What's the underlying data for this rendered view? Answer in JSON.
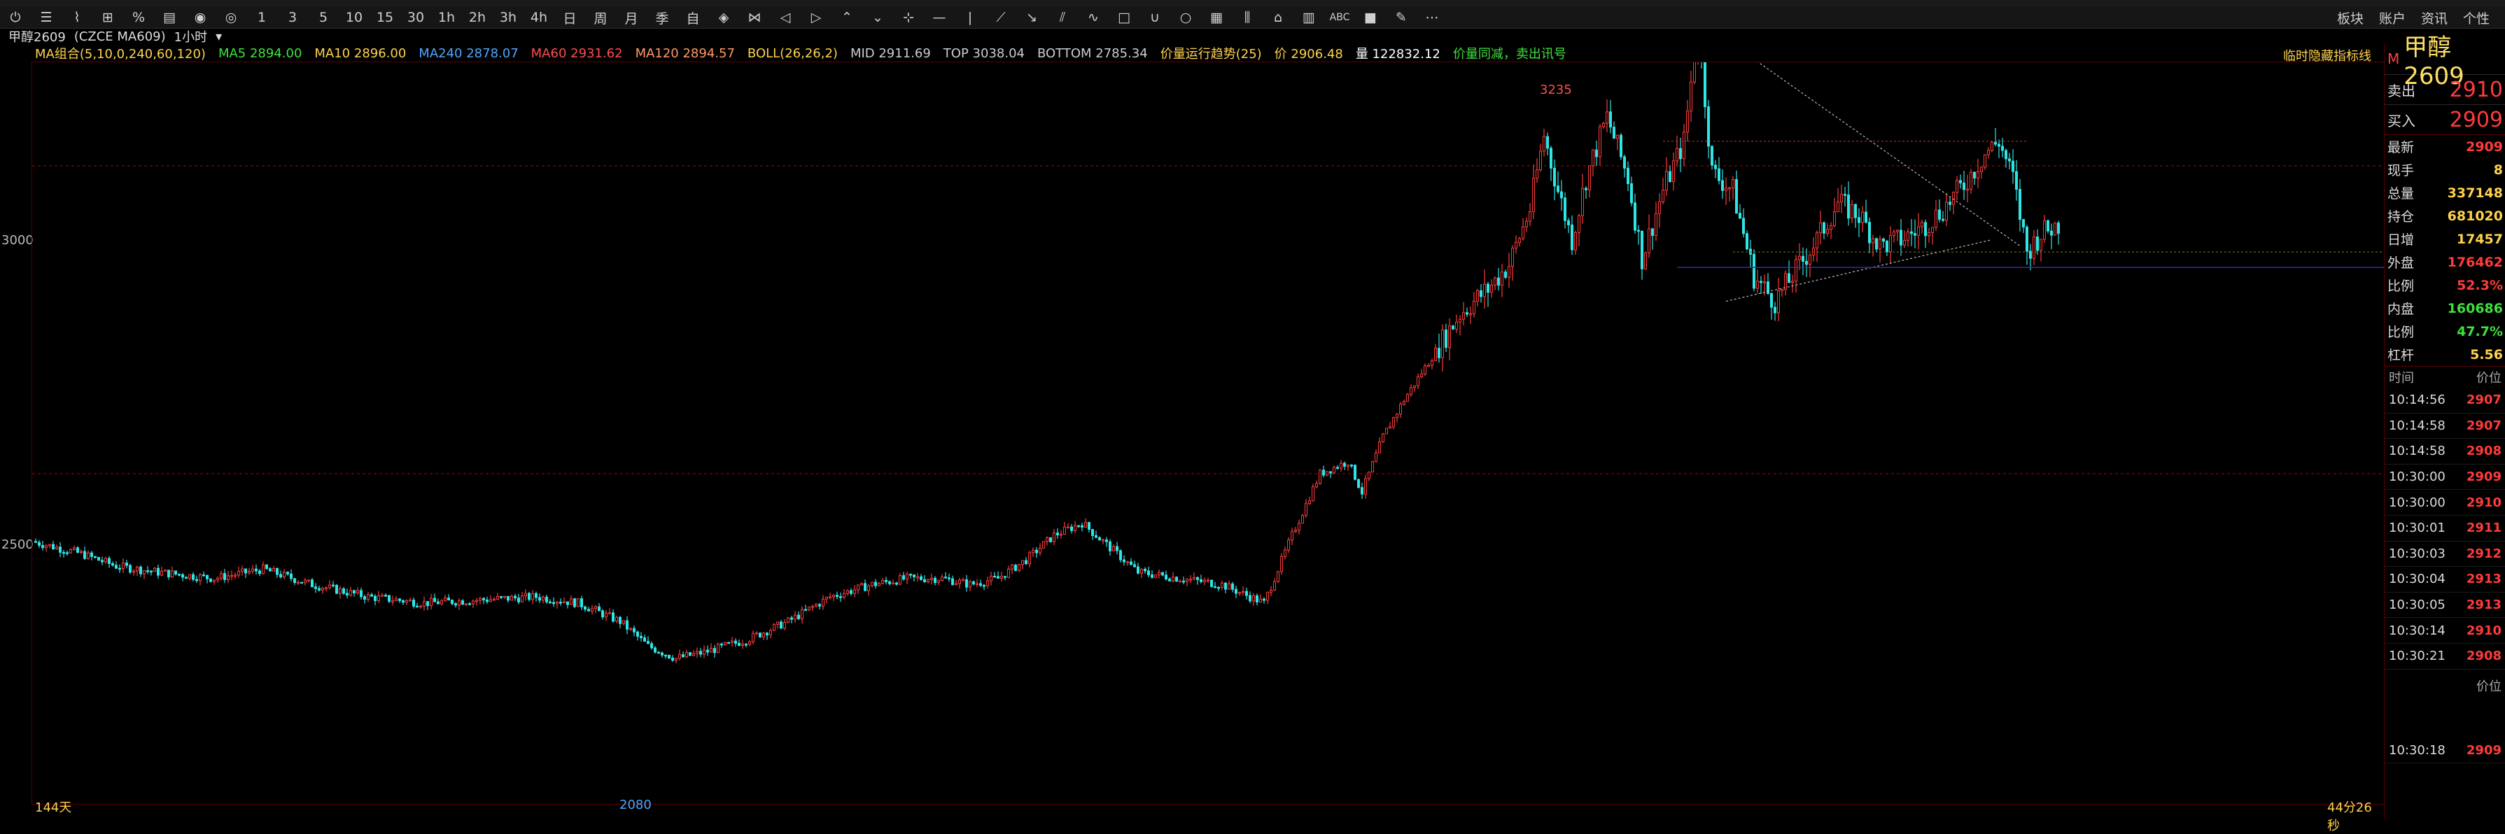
{
  "toolbar": {
    "icons": [
      "power-icon",
      "list-icon",
      "line-chart-icon",
      "candle-chart-icon",
      "bar-grid-icon",
      "number-icon",
      "radio-icon",
      "fund-icon",
      "target-icon"
    ],
    "periods": [
      "1",
      "3",
      "5",
      "10",
      "15",
      "30",
      "1h",
      "2h",
      "3h",
      "4h",
      "日",
      "周",
      "月",
      "季",
      "自"
    ],
    "right_items": [
      "板块",
      "账户",
      "资讯",
      "个性"
    ]
  },
  "subbar": {
    "symbol": "甲醇2609",
    "exchange": "(CZCE MA609)",
    "period": "1小时"
  },
  "indicators": [
    {
      "text": "MA组合(5,10,0,240,60,120)",
      "color": "#ffd24d"
    },
    {
      "text": "MA5 2894.00",
      "color": "#3fe03f"
    },
    {
      "text": "MA10 2896.00",
      "color": "#ffd24d"
    },
    {
      "text": "MA240 2878.07",
      "color": "#4da6ff"
    },
    {
      "text": "MA60 2931.62",
      "color": "#ff4d4d"
    },
    {
      "text": "MA120 2894.57",
      "color": "#ff9966"
    },
    {
      "text": "BOLL(26,26,2)",
      "color": "#ffd24d"
    },
    {
      "text": "MID 2911.69",
      "color": "#cccccc"
    },
    {
      "text": "TOP 3038.04",
      "color": "#cccccc"
    },
    {
      "text": "BOTTOM 2785.34",
      "color": "#cccccc"
    },
    {
      "text": "价量运行趋势(25)",
      "color": "#ffd24d"
    },
    {
      "text": "价 2906.48",
      "color": "#ffd24d"
    },
    {
      "text": "量 122832.12",
      "color": "#ffffff"
    },
    {
      "text": "价量同减，卖出讯号",
      "color": "#3fe03f"
    }
  ],
  "indicator_right": "临时隐藏指标线",
  "chart_data": {
    "type": "candlestick",
    "ylabel_ticks": [
      "3000",
      "2500"
    ],
    "y_ticks_values": [
      3000,
      2500
    ],
    "high_label": "3235",
    "low_label": "2080",
    "bar_count_label": "144天",
    "bottom_right_label": "44分26秒",
    "trendlines": [
      "descending upper line from 3235 peak",
      "ascending lower line from recent low",
      "horizontal support around 2860"
    ]
  },
  "quote": {
    "title": "甲醇2609",
    "sell_label": "卖出",
    "sell_price": "2910",
    "buy_label": "买入",
    "buy_price": "2909",
    "rows": [
      {
        "label": "最新",
        "value": "2909",
        "color": "#ff3b3b"
      },
      {
        "label": "现手",
        "value": "8",
        "color": "#ffd24d"
      },
      {
        "label": "总量",
        "value": "337148",
        "color": "#ffd24d"
      },
      {
        "label": "持仓",
        "value": "681020",
        "color": "#ffd24d"
      },
      {
        "label": "日增",
        "value": "17457",
        "color": "#ffd24d"
      },
      {
        "label": "外盘",
        "value": "176462",
        "color": "#ff3b3b"
      },
      {
        "label": "比例",
        "value": "52.3%",
        "color": "#ff3b3b"
      },
      {
        "label": "内盘",
        "value": "160686",
        "color": "#3fe03f"
      },
      {
        "label": "比例",
        "value": "47.7%",
        "color": "#3fe03f"
      },
      {
        "label": "杠杆",
        "value": "5.56",
        "color": "#ffd24d"
      }
    ]
  },
  "trades": {
    "head_time": "时间",
    "head_price": "价位",
    "rows": [
      {
        "time": "10:14:56",
        "price": "2907"
      },
      {
        "time": "10:14:58",
        "price": "2907"
      },
      {
        "time": "10:14:58",
        "price": "2908"
      },
      {
        "time": "10:30:00",
        "price": "2909"
      },
      {
        "time": "10:30:00",
        "price": "2910"
      },
      {
        "time": "10:30:01",
        "price": "2911"
      },
      {
        "time": "10:30:03",
        "price": "2912"
      },
      {
        "time": "10:30:04",
        "price": "2913"
      },
      {
        "time": "10:30:05",
        "price": "2913"
      },
      {
        "time": "10:30:14",
        "price": "2910"
      },
      {
        "time": "10:30:21",
        "price": "2908"
      }
    ],
    "head_price2": "价位",
    "extra_time": "10:30:18",
    "extra_price": "2909"
  }
}
